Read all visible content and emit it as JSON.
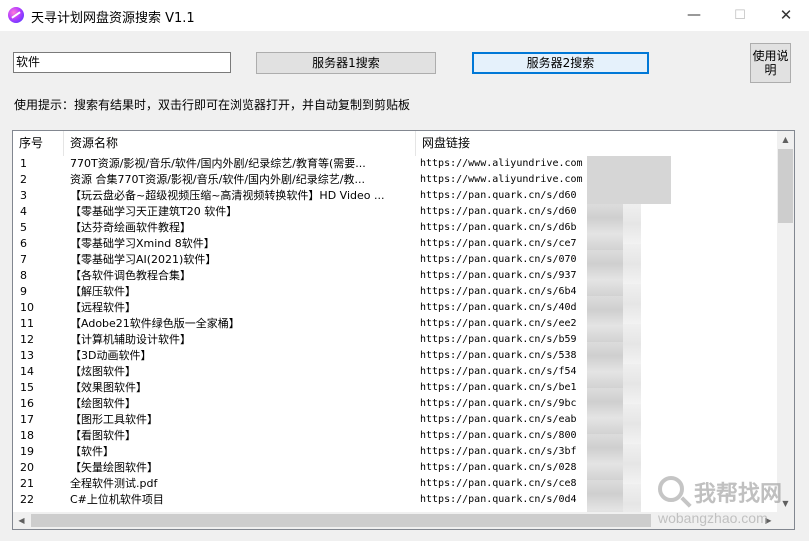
{
  "window": {
    "title": "天寻计划网盘资源搜索 V1.1",
    "controls": {
      "minimize": "—",
      "maximize": "☐",
      "close": "✕"
    }
  },
  "search": {
    "value": "软件"
  },
  "buttons": {
    "server1": "服务器1搜索",
    "server2": "服务器2搜索",
    "help": "使用说明"
  },
  "tip": "使用提示：搜索有结果时，双击行即可在浏览器打开，并自动复制到剪贴板",
  "table": {
    "columns": [
      "序号",
      "资源名称",
      "网盘链接"
    ],
    "rows": [
      {
        "no": "1",
        "name": "770T资源/影视/音乐/软件/国内外剧/纪录综艺/教育等(需要...",
        "link": "https://www.aliyundrive.com"
      },
      {
        "no": "2",
        "name": "资源 合集770T资源/影视/音乐/软件/国内外剧/纪录综艺/教...",
        "link": "https://www.aliyundrive.com"
      },
      {
        "no": "3",
        "name": "【玩云盘必备~超级视频压缩~高清视频转换软件】HD Video ...",
        "link": "https://pan.quark.cn/s/d60"
      },
      {
        "no": "4",
        "name": "【零基础学习天正建筑T20 软件】",
        "link": "https://pan.quark.cn/s/d60"
      },
      {
        "no": "5",
        "name": "【达芬奇绘画软件教程】",
        "link": "https://pan.quark.cn/s/d6b"
      },
      {
        "no": "6",
        "name": "【零基础学习Xmind 8软件】",
        "link": "https://pan.quark.cn/s/ce7"
      },
      {
        "no": "7",
        "name": "【零基础学习AI(2021)软件】",
        "link": "https://pan.quark.cn/s/070"
      },
      {
        "no": "8",
        "name": "【各软件调色教程合集】",
        "link": "https://pan.quark.cn/s/937"
      },
      {
        "no": "9",
        "name": "【解压软件】",
        "link": "https://pan.quark.cn/s/6b4"
      },
      {
        "no": "10",
        "name": "【远程软件】",
        "link": "https://pan.quark.cn/s/40d"
      },
      {
        "no": "11",
        "name": "【Adobe21软件绿色版一全家桶】",
        "link": "https://pan.quark.cn/s/ee2"
      },
      {
        "no": "12",
        "name": "【计算机辅助设计软件】",
        "link": "https://pan.quark.cn/s/b59"
      },
      {
        "no": "13",
        "name": "【3D动画软件】",
        "link": "https://pan.quark.cn/s/538"
      },
      {
        "no": "14",
        "name": "【炫图软件】",
        "link": "https://pan.quark.cn/s/f54"
      },
      {
        "no": "15",
        "name": "【效果图软件】",
        "link": "https://pan.quark.cn/s/be1"
      },
      {
        "no": "16",
        "name": "【绘图软件】",
        "link": "https://pan.quark.cn/s/9bc"
      },
      {
        "no": "17",
        "name": "【图形工具软件】",
        "link": "https://pan.quark.cn/s/eab"
      },
      {
        "no": "18",
        "name": "【看图软件】",
        "link": "https://pan.quark.cn/s/800"
      },
      {
        "no": "19",
        "name": "【软件】",
        "link": "https://pan.quark.cn/s/3bf"
      },
      {
        "no": "20",
        "name": "【矢量绘图软件】",
        "link": "https://pan.quark.cn/s/028"
      },
      {
        "no": "21",
        "name": "全程软件测试.pdf",
        "link": "https://pan.quark.cn/s/ce8"
      },
      {
        "no": "22",
        "name": "C#上位机软件项目",
        "link": "https://pan.quark.cn/s/0d4"
      }
    ]
  },
  "scroll": {
    "up": "▲",
    "down": "▼",
    "left": "◀",
    "right": "▶"
  },
  "watermark": {
    "text": "我帮找网",
    "url": "wobangzhao.com"
  }
}
